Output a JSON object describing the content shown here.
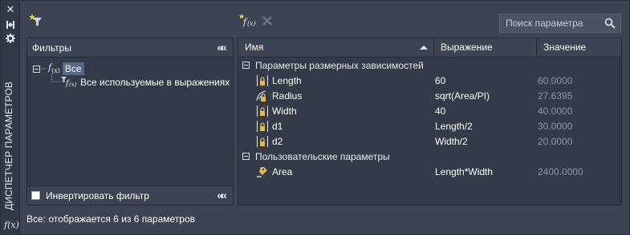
{
  "side": {
    "title": "ДИСПЕТЧЕР ПАРАМЕТРОВ",
    "buttons": [
      "close-icon",
      "pin-icon",
      "settings-icon"
    ],
    "fx_icon": "f(x)"
  },
  "toolbar": {
    "icons": [
      "new-filter-icon",
      "new-user-parameter-icon",
      "delete-icon"
    ],
    "search_placeholder": "Поиск параметра"
  },
  "filters": {
    "title": "Фильтры",
    "tree": {
      "root_label": "Все",
      "child_label": "Все используемые в выражениях"
    },
    "invert_label": "Инвертировать фильтр",
    "invert_checked": false
  },
  "grid": {
    "columns": [
      "Имя",
      "Выражение",
      "Значение"
    ],
    "sort_column": "Имя",
    "groups": [
      {
        "label": "Параметры размерных зависимостей",
        "rows": [
          {
            "icon": "linear-dim-lock-icon",
            "name": "Length",
            "expr": "60",
            "value": "60.0000"
          },
          {
            "icon": "radial-dim-lock-icon",
            "name": "Radius",
            "expr": "sqrt(Area/PI)",
            "value": "27.6395"
          },
          {
            "icon": "linear-dim-lock-icon",
            "name": "Width",
            "expr": "40",
            "value": "40.0000"
          },
          {
            "icon": "linear-dim-lock-icon",
            "name": "d1",
            "expr": "Length/2",
            "value": "30.0000"
          },
          {
            "icon": "linear-dim-lock-icon",
            "name": "d2",
            "expr": "Width/2",
            "value": "20.0000"
          }
        ]
      },
      {
        "label": "Пользовательские параметры",
        "rows": [
          {
            "icon": "user-parameter-icon",
            "name": "Area",
            "expr": "Length*Width",
            "value": "2400.0000"
          }
        ]
      }
    ]
  },
  "status": "Все: отображается 6 из 6 параметров",
  "colors": {
    "background": "#3b4453",
    "panel": "#333b48",
    "selection": "#56698a",
    "lock": "#e8b84a",
    "muted_value": "#8f97a3"
  }
}
